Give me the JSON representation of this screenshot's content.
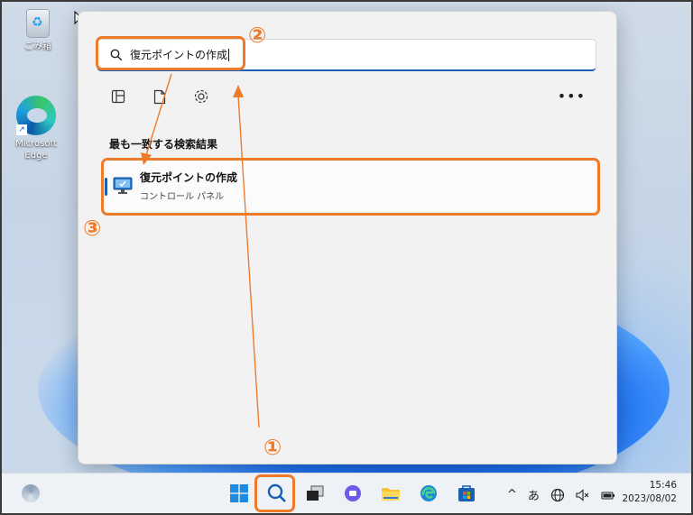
{
  "desktop": {
    "recycle_bin_label": "ごみ箱",
    "edge_label": "Microsoft Edge"
  },
  "start_menu": {
    "search_value": "復元ポイントの作成",
    "filters": [
      "apps-filter-icon",
      "documents-filter-icon",
      "settings-filter-icon"
    ],
    "more_label": "•••",
    "section_title": "最も一致する検索結果",
    "best_match": {
      "title": "復元ポイントの作成",
      "subtitle": "コントロール パネル"
    }
  },
  "taskbar": {
    "apps": [
      "start-icon",
      "search-icon",
      "task-view-icon",
      "chat-icon",
      "file-explorer-icon",
      "edge-icon",
      "store-icon"
    ],
    "tray": {
      "chevron": "^",
      "ime": "あ"
    },
    "time": "15:46",
    "date": "2023/08/02"
  },
  "annotations": {
    "step1": "①",
    "step2": "②",
    "step3": "③"
  },
  "colors": {
    "accent": "#ee7b2a",
    "windows_blue": "#1a5fb4"
  }
}
